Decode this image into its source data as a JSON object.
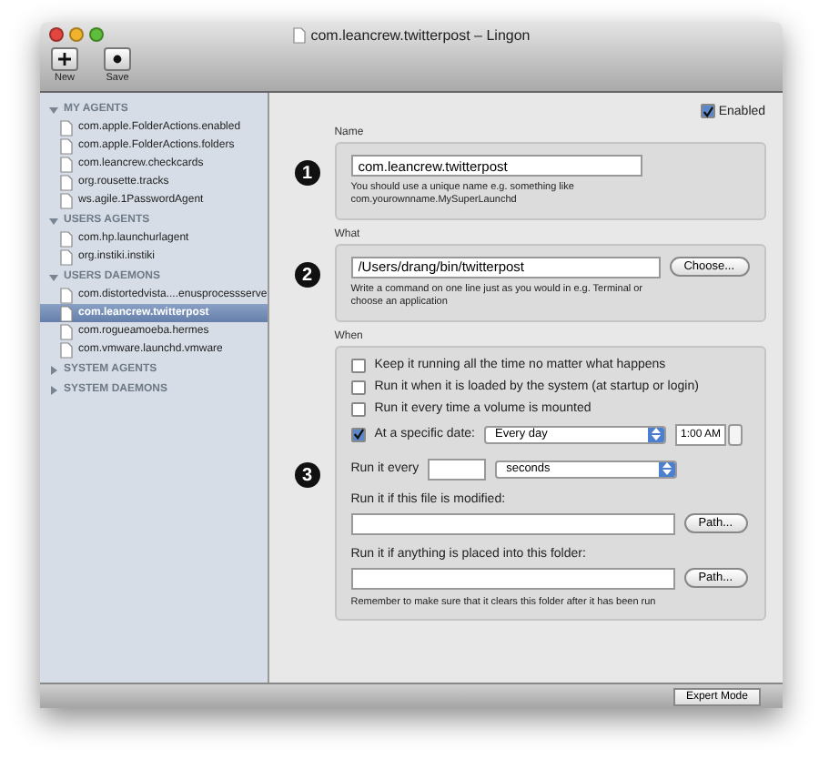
{
  "window": {
    "title": "com.leancrew.twitterpost – Lingon"
  },
  "toolbar": [
    {
      "label": "New",
      "kind": "new"
    },
    {
      "label": "Save",
      "kind": "save"
    }
  ],
  "sidebar": {
    "groups": [
      {
        "label": "MY AGENTS",
        "expanded": true,
        "items": [
          {
            "label": "com.apple.FolderActions.enabled",
            "selected": false
          },
          {
            "label": "com.apple.FolderActions.folders",
            "selected": false
          },
          {
            "label": "com.leancrew.checkcards",
            "selected": false
          },
          {
            "label": "org.rousette.tracks",
            "selected": false
          },
          {
            "label": "ws.agile.1PasswordAgent",
            "selected": false
          }
        ]
      },
      {
        "label": "USERS AGENTS",
        "expanded": true,
        "items": [
          {
            "label": "com.hp.launchurlagent",
            "selected": false
          },
          {
            "label": "org.instiki.instiki",
            "selected": false
          }
        ]
      },
      {
        "label": "USERS DAEMONS",
        "expanded": true,
        "items": [
          {
            "label": "com.distortedvista....enusprocessserve",
            "selected": false
          },
          {
            "label": "com.leancrew.twitterpost",
            "selected": true
          },
          {
            "label": "com.rogueamoeba.hermes",
            "selected": false
          },
          {
            "label": "com.vmware.launchd.vmware",
            "selected": false
          }
        ]
      },
      {
        "label": "SYSTEM AGENTS",
        "expanded": false
      },
      {
        "label": "SYSTEM DAEMONS",
        "expanded": false
      }
    ]
  },
  "enabled": {
    "label": "Enabled",
    "checked": true
  },
  "name_section": {
    "label": "Name",
    "step": "1",
    "value": "com.leancrew.twitterpost",
    "hint": "You should use a unique name e.g. something like com.yourownname.MySuperLaunchd"
  },
  "what_section": {
    "label": "What",
    "step": "2",
    "value": "/Users/drang/bin/twitterpost",
    "button": "Choose...",
    "hint": "Write a command on one line just as you would in e.g. Terminal or choose an application"
  },
  "when_section": {
    "label": "When",
    "step": "3",
    "options": [
      {
        "label": "Keep it running all the time no matter what happens",
        "checked": false
      },
      {
        "label": "Run it when it is loaded by the system (at startup or login)",
        "checked": false
      },
      {
        "label": "Run it every time a volume is mounted",
        "checked": false
      }
    ],
    "date": {
      "label": "At a specific date:",
      "checked": true,
      "frequency": "Every day",
      "time": "1:00 AM"
    },
    "interval": {
      "label": "Run it every",
      "unit": "seconds"
    },
    "file": {
      "label": "Run it if this file is modified:",
      "button": "Path..."
    },
    "folder": {
      "label": "Run it if anything is placed into this folder:",
      "button": "Path...",
      "hint": "Remember to make sure that it clears this folder after it has been run"
    }
  },
  "bottom_bar": {
    "button": "Expert Mode"
  }
}
